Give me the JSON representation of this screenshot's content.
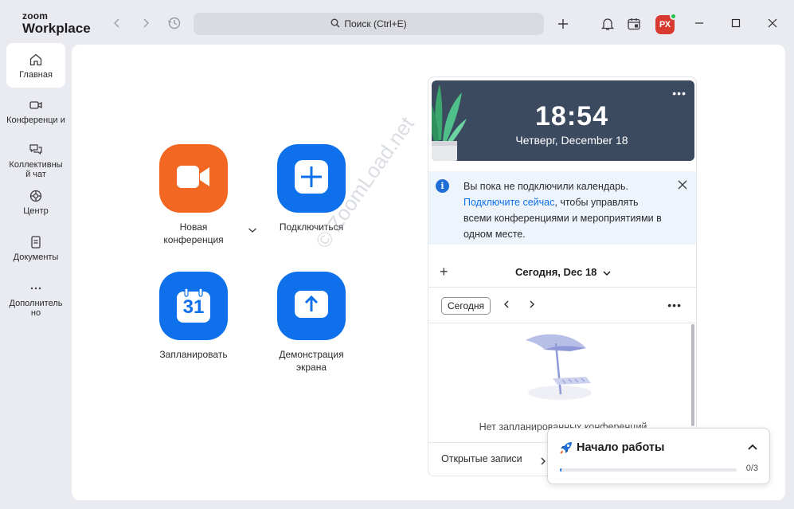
{
  "app": {
    "logo_line1": "zoom",
    "logo_line2": "Workplace"
  },
  "titlebar": {
    "search_label": "Поиск (Ctrl+E)",
    "avatar_initials": "РХ",
    "presence_color": "#1fc24a",
    "avatar_color": "#d93a2f"
  },
  "sidebar": {
    "items": [
      {
        "label": "Главная",
        "icon": "home-icon",
        "active": true
      },
      {
        "label": "Конференци и",
        "icon": "video-camera-icon"
      },
      {
        "label": "Коллективны й чат",
        "icon": "chat-icon"
      },
      {
        "label": "Центр",
        "icon": "hub-icon"
      },
      {
        "label": "Документы",
        "icon": "document-icon"
      },
      {
        "label": "Дополнитель но",
        "icon": "more-icon"
      }
    ]
  },
  "actions": {
    "new_meeting": "Новая конференция",
    "join": "Подключиться",
    "schedule": "Запланировать",
    "schedule_day": "31",
    "share_screen": "Демонстрация экрана"
  },
  "calendar": {
    "time": "18:54",
    "date": "Четверг, December 18",
    "notice_text_1": "Вы пока не подключили календарь.",
    "notice_link": "Подключите сейчас",
    "notice_text_2": ", чтобы управлять всеми конференциями и мероприятиями в одном месте.",
    "day_title": "Сегодня, Dec 18",
    "today_button": "Сегодня",
    "empty_text": "Нет запланированных конференций",
    "open_notes": "Открытые записи"
  },
  "getting_started": {
    "title": "Начало работы",
    "progress": "0/3",
    "progress_fraction": 0.01
  },
  "colors": {
    "orange": "#f26722",
    "blue": "#0e71eb",
    "header_bg": "#3c4a60"
  },
  "watermark": "© ZoomLoad.net"
}
